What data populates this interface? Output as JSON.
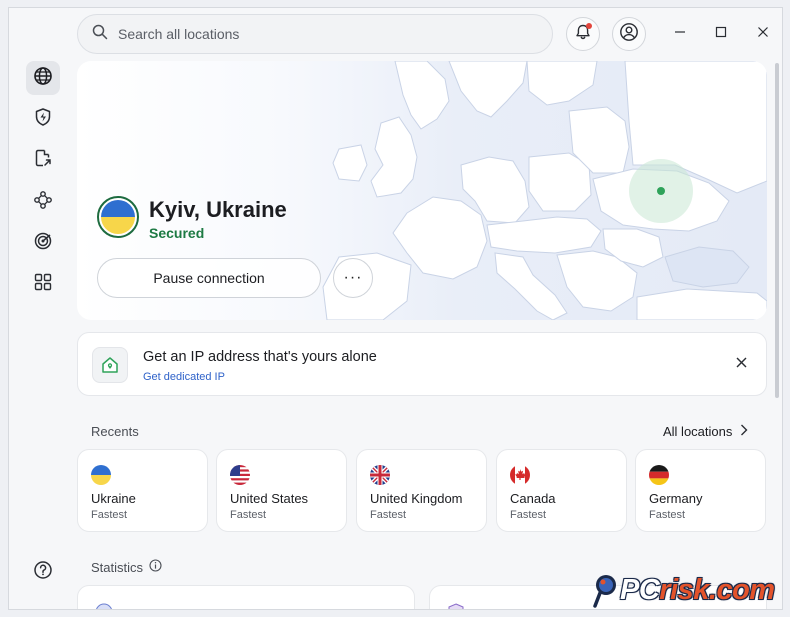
{
  "search": {
    "placeholder": "Search all locations"
  },
  "icons": {
    "search": "search-icon",
    "bell": "bell-icon",
    "profile": "user-icon",
    "minimize": "minimize-icon",
    "maximize": "maximize-icon",
    "close": "close-icon"
  },
  "sidebar": {
    "items": [
      {
        "name": "globe-icon",
        "active": true
      },
      {
        "name": "shield-bolt-icon",
        "active": false
      },
      {
        "name": "file-share-icon",
        "active": false
      },
      {
        "name": "meshnet-icon",
        "active": false
      },
      {
        "name": "target-icon",
        "active": false
      },
      {
        "name": "apps-icon",
        "active": false
      }
    ],
    "help": "help-icon"
  },
  "hero": {
    "location": "Kyiv, Ukraine",
    "status": "Secured",
    "pause_label": "Pause connection",
    "more_label": "···"
  },
  "banner": {
    "title": "Get an IP address that's yours alone",
    "link": "Get dedicated IP"
  },
  "recents": {
    "label": "Recents",
    "all_locations": "All locations",
    "items": [
      {
        "country": "Ukraine",
        "sub": "Fastest",
        "flag": "ukraine-flag-icon"
      },
      {
        "country": "United States",
        "sub": "Fastest",
        "flag": "usa-flag-icon"
      },
      {
        "country": "United Kingdom",
        "sub": "Fastest",
        "flag": "uk-flag-icon"
      },
      {
        "country": "Canada",
        "sub": "Fastest",
        "flag": "canada-flag-icon"
      },
      {
        "country": "Germany",
        "sub": "Fastest",
        "flag": "germany-flag-icon"
      }
    ]
  },
  "statistics": {
    "label": "Statistics"
  },
  "watermark": {
    "text": "PC",
    "text2": "risk.com"
  },
  "colors": {
    "accent_green": "#1d7a43",
    "link_blue": "#2f62c9",
    "ukraine_blue": "#2f6fd0",
    "ukraine_yellow": "#f7d64a"
  }
}
